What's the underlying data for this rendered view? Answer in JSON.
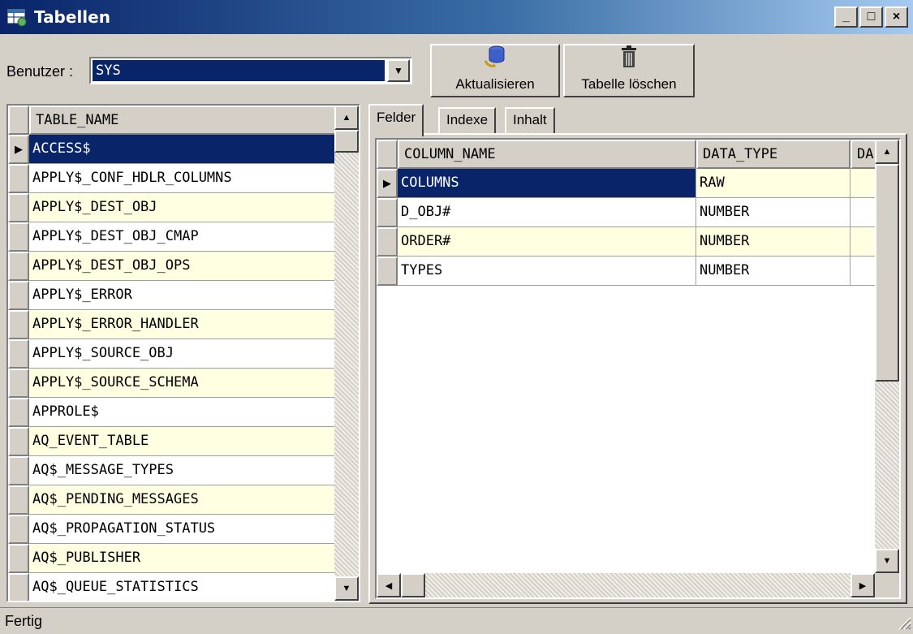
{
  "window": {
    "title": "Tabellen",
    "minimize": "_",
    "maximize": "□",
    "close": "×"
  },
  "toolbar": {
    "user_label": "Benutzer :",
    "user_value": "SYS",
    "refresh_label": "Aktualisieren",
    "delete_label": "Tabelle löschen"
  },
  "tables": {
    "header": "TABLE_NAME",
    "rows": [
      "ACCESS$",
      "APPLY$_CONF_HDLR_COLUMNS",
      "APPLY$_DEST_OBJ",
      "APPLY$_DEST_OBJ_CMAP",
      "APPLY$_DEST_OBJ_OPS",
      "APPLY$_ERROR",
      "APPLY$_ERROR_HANDLER",
      "APPLY$_SOURCE_OBJ",
      "APPLY$_SOURCE_SCHEMA",
      "APPROLE$",
      "AQ_EVENT_TABLE",
      "AQ$_MESSAGE_TYPES",
      "AQ$_PENDING_MESSAGES",
      "AQ$_PROPAGATION_STATUS",
      "AQ$_PUBLISHER",
      "AQ$_QUEUE_STATISTICS"
    ]
  },
  "tabs": [
    "Felder",
    "Indexe",
    "Inhalt"
  ],
  "fields": {
    "headers": [
      "COLUMN_NAME",
      "DATA_TYPE",
      "DA"
    ],
    "rows": [
      {
        "column_name": "COLUMNS",
        "data_type": "RAW"
      },
      {
        "column_name": "D_OBJ#",
        "data_type": "NUMBER"
      },
      {
        "column_name": "ORDER#",
        "data_type": "NUMBER"
      },
      {
        "column_name": "TYPES",
        "data_type": "NUMBER"
      }
    ]
  },
  "status": {
    "text": "Fertig"
  },
  "colors": {
    "selection": "#0a246a",
    "alt_row": "#ffffe1",
    "face": "#d4d0c8"
  }
}
